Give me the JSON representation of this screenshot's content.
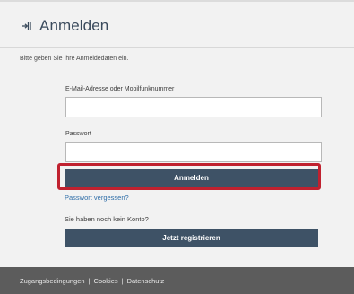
{
  "header": {
    "title": "Anmelden",
    "icon": "login-icon"
  },
  "instruction": "Bitte geben Sie Ihre Anmeldedaten ein.",
  "form": {
    "email_label": "E-Mail-Adresse oder Mobilfunknummer",
    "email_value": "",
    "password_label": "Passwort",
    "password_value": "",
    "submit_label": "Anmelden",
    "forgot_link": "Passwort vergessen?",
    "no_account_text": "Sie haben noch kein Konto?",
    "register_label": "Jetzt registrieren"
  },
  "footer": {
    "links": [
      "Zugangsbedingungen",
      "Cookies",
      "Datenschutz"
    ],
    "separator": "|"
  },
  "colors": {
    "primary_button": "#3e5266",
    "highlight": "#c0212f",
    "link": "#2f6ea8",
    "footer_bg": "#5c5c5c"
  }
}
